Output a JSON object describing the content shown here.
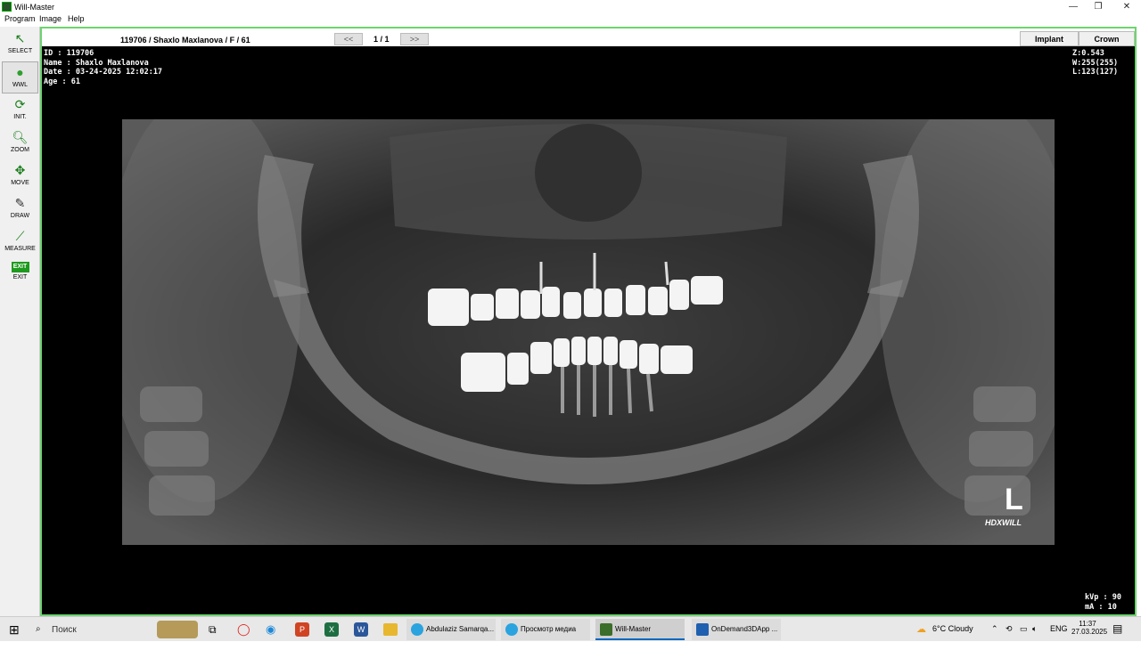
{
  "window": {
    "title": "Will-Master"
  },
  "menu": [
    "Program",
    "Image",
    "Help"
  ],
  "toolbar": [
    {
      "label": "SELECT",
      "icon": "↖",
      "color": "#1a7d1a"
    },
    {
      "label": "WWL",
      "icon": "●",
      "color": "#2f9f2f"
    },
    {
      "label": "INIT.",
      "icon": "⟳",
      "color": "#1a7d1a"
    },
    {
      "label": "ZOOM",
      "icon": "🔍︎",
      "color": "#1a7d1a"
    },
    {
      "label": "MOVE",
      "icon": "✥",
      "color": "#1a7d1a"
    },
    {
      "label": "DRAW",
      "icon": "✎",
      "color": "#333333"
    },
    {
      "label": "MEASURE",
      "icon": "⟋",
      "color": "#1a7d1a"
    },
    {
      "label": "EXIT",
      "icon": "EXIT",
      "color": "#ffffff"
    }
  ],
  "viewer": {
    "header": "119706 / Shaxlo Maxlanova / F / 61",
    "prev": "<<",
    "next": ">>",
    "page": "1 / 1",
    "tabs": [
      "Implant",
      "Crown"
    ],
    "info": {
      "id": "ID : 119706",
      "name": "Name : Shaxlo Maxlanova",
      "date": "Date : 03-24-2025 12:02:17",
      "age": "Age : 61"
    },
    "params": {
      "z": "Z:0.543",
      "w": "W:255(255)",
      "l": "L:123(127)"
    },
    "exposure": {
      "kvp": "kVp : 90",
      "ma": "mA : 10"
    },
    "side_marker": "L",
    "brand": "HDXWILL"
  },
  "taskbar": {
    "search": "Поиск",
    "apps": [
      {
        "label": "Abdulaziz Samarqa...",
        "color": "#2aa3df"
      },
      {
        "label": "Просмотр медиа",
        "color": "#2aa3df"
      },
      {
        "label": "Will-Master",
        "color": "#3a6e2a"
      },
      {
        "label": "OnDemand3DApp ...",
        "color": "#1f5fb0"
      }
    ],
    "weather": "6°C  Cloudy",
    "lang": "ENG",
    "time": "11:37",
    "date": "27.03.2025"
  }
}
